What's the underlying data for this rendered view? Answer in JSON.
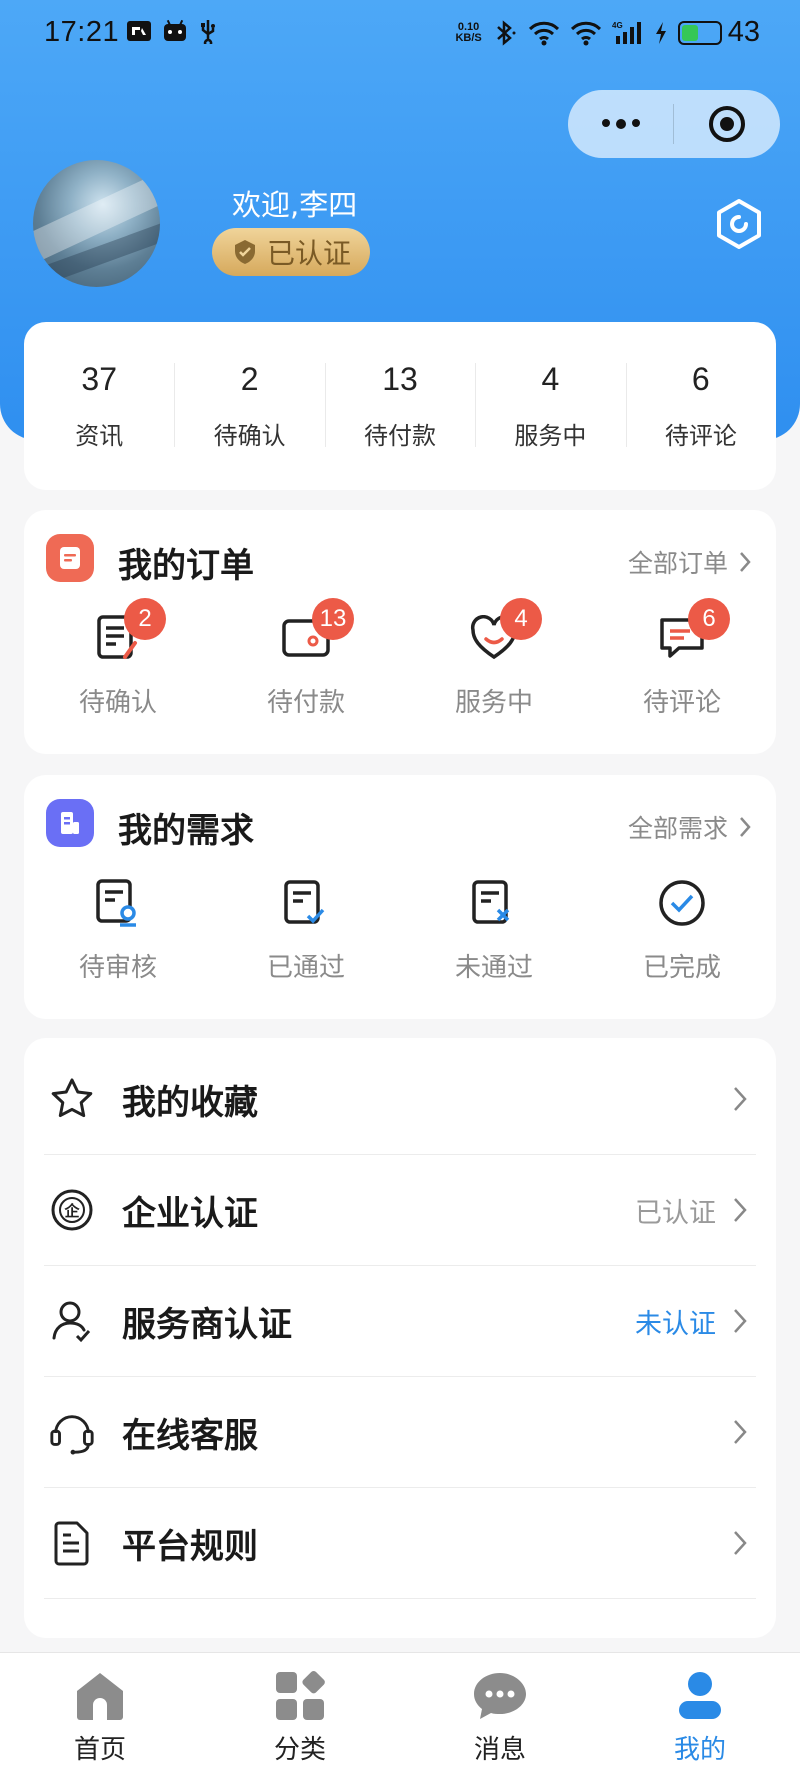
{
  "status_bar": {
    "time": "17:21",
    "net_speed_top": "0.10",
    "net_speed_bottom": "KB/S",
    "battery": "43"
  },
  "profile": {
    "welcome": "欢迎,李四",
    "badge": "已认证"
  },
  "stats": [
    {
      "value": "37",
      "label": "资讯"
    },
    {
      "value": "2",
      "label": "待确认"
    },
    {
      "value": "13",
      "label": "待付款"
    },
    {
      "value": "4",
      "label": "服务中"
    },
    {
      "value": "6",
      "label": "待评论"
    }
  ],
  "orders": {
    "title": "我的订单",
    "link": "全部订单",
    "items": [
      {
        "label": "待确认",
        "badge": "2",
        "icon": "doc-edit-icon"
      },
      {
        "label": "待付款",
        "badge": "13",
        "icon": "wallet-icon"
      },
      {
        "label": "服务中",
        "badge": "4",
        "icon": "heart-smile-icon"
      },
      {
        "label": "待评论",
        "badge": "6",
        "icon": "comment-icon"
      }
    ]
  },
  "demands": {
    "title": "我的需求",
    "link": "全部需求",
    "items": [
      {
        "label": "待审核",
        "icon": "doc-review-icon"
      },
      {
        "label": "已通过",
        "icon": "doc-check-icon"
      },
      {
        "label": "未通过",
        "icon": "doc-x-icon"
      },
      {
        "label": "已完成",
        "icon": "circle-check-icon"
      }
    ]
  },
  "menu": [
    {
      "label": "我的收藏",
      "value": "",
      "icon": "star-icon"
    },
    {
      "label": "企业认证",
      "value": "已认证",
      "icon": "enterprise-icon"
    },
    {
      "label": "服务商认证",
      "value": "未认证",
      "icon": "user-check-icon"
    },
    {
      "label": "在线客服",
      "value": "",
      "icon": "headset-icon"
    },
    {
      "label": "平台规则",
      "value": "",
      "icon": "document-icon"
    }
  ],
  "tabs": [
    {
      "label": "首页",
      "icon": "home-icon"
    },
    {
      "label": "分类",
      "icon": "category-icon"
    },
    {
      "label": "消息",
      "icon": "message-icon"
    },
    {
      "label": "我的",
      "icon": "user-icon",
      "active": true
    }
  ],
  "colors": {
    "header": "#3a98f2",
    "badge_red": "#ec5a47",
    "accent_blue": "#2a8ae6",
    "gold": "#d6a95c"
  }
}
